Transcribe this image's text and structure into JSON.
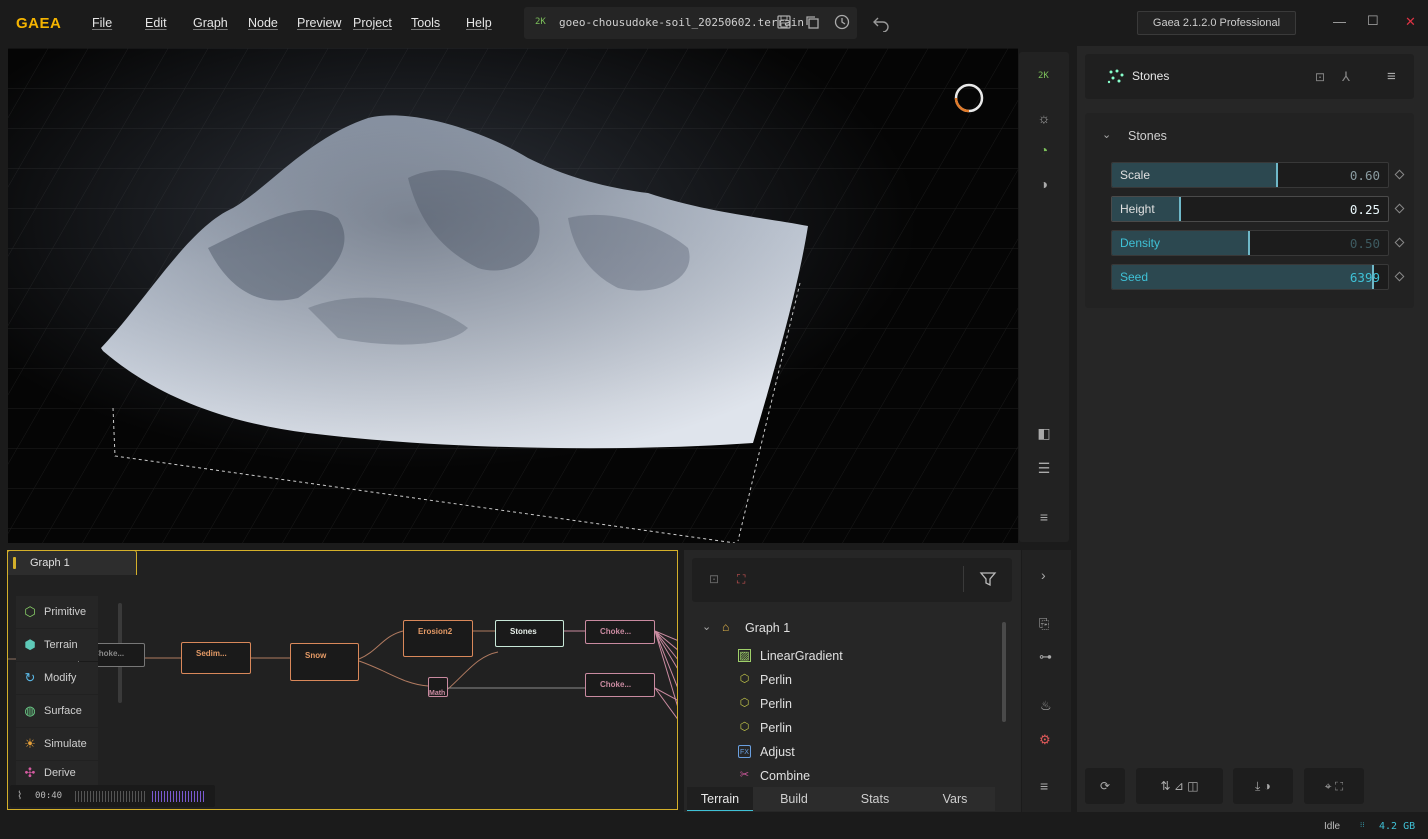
{
  "app": {
    "logo": "GAEA",
    "version": "Gaea 2.1.2.0 Professional"
  },
  "menu": [
    "File",
    "Edit",
    "Graph",
    "Node",
    "Preview",
    "Project",
    "Tools",
    "Help"
  ],
  "file": {
    "resolution_badge": "2K",
    "name": "goeo-chousudoke-soil_20250602.terrain"
  },
  "viewport": {
    "toolbar_badge": "2K"
  },
  "properties": {
    "node_name": "Stones",
    "section": "Stones",
    "params": [
      {
        "label": "Scale",
        "value": "0.60",
        "fraction": 0.6
      },
      {
        "label": "Height",
        "value": "0.25",
        "fraction": 0.25
      },
      {
        "label": "Density",
        "value": "0.50",
        "fraction": 0.5
      },
      {
        "label": "Seed",
        "value": "6399",
        "fraction": 0.95
      }
    ]
  },
  "graph": {
    "tab": "Graph 1",
    "categories": [
      "Primitive",
      "Terrain",
      "Modify",
      "Surface",
      "Simulate",
      "Derive"
    ],
    "timeline": "00:40",
    "nodes": [
      "Choke...",
      "Sedim...",
      "Snow",
      "Erosion2",
      "Stones",
      "Choke...",
      "Math",
      "Choke..."
    ]
  },
  "hierarchy": {
    "root": "Graph 1",
    "items": [
      {
        "label": "LinearGradient",
        "icon": "gradient-icon"
      },
      {
        "label": "Perlin",
        "icon": "hexagon-icon"
      },
      {
        "label": "Perlin",
        "icon": "hexagon-icon"
      },
      {
        "label": "Perlin",
        "icon": "hexagon-icon"
      },
      {
        "label": "Adjust",
        "icon": "fx-icon"
      },
      {
        "label": "Combine",
        "icon": "combine-icon"
      }
    ],
    "tabs": [
      "Terrain",
      "Build",
      "Stats",
      "Vars"
    ]
  },
  "status": {
    "state": "Idle",
    "memory": "4.2 GB"
  },
  "colors": {
    "accent": "#f5b400",
    "teal": "#3fc1d6",
    "node_orange": "#d9885a"
  }
}
